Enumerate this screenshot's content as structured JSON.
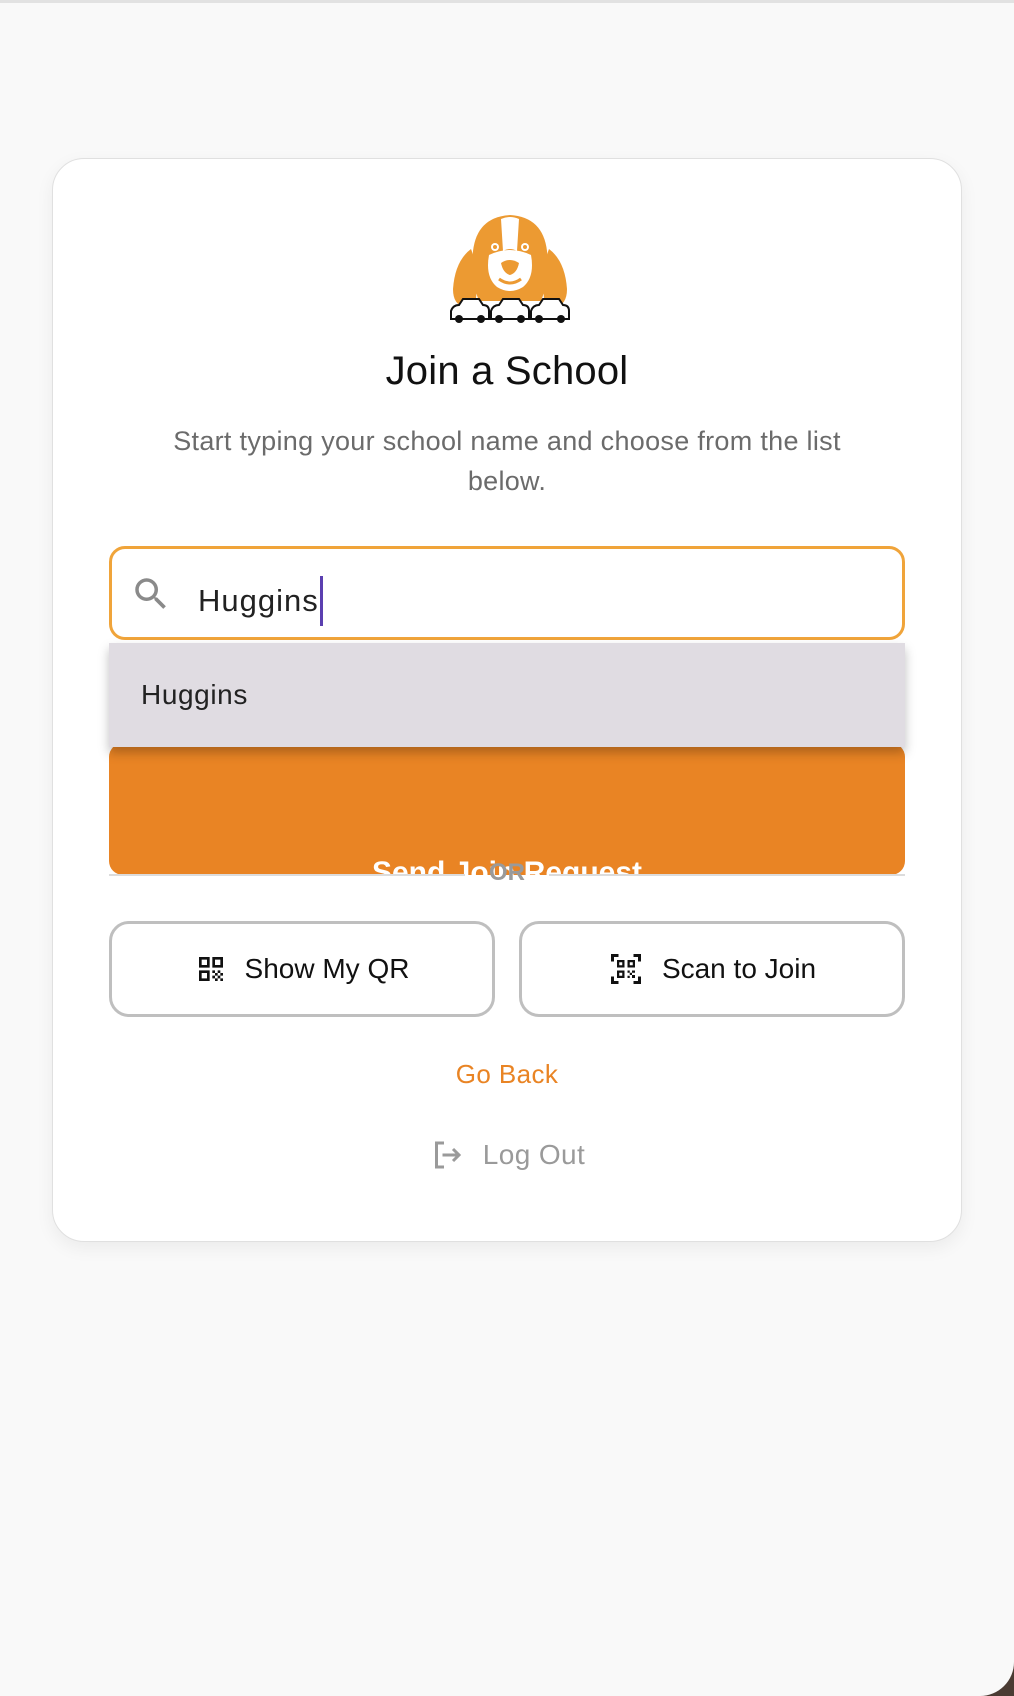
{
  "page": {
    "title": "Join a School",
    "subtitle": "Start typing your school name and choose from the list below."
  },
  "search": {
    "value": "Huggins",
    "icon": "search-icon"
  },
  "dropdown": {
    "options": [
      "Huggins"
    ]
  },
  "actions": {
    "send_label": "Send Join Request",
    "or_label": "OR",
    "show_qr_label": "Show My QR",
    "scan_label": "Scan to Join",
    "go_back_label": "Go Back",
    "logout_label": "Log Out"
  },
  "colors": {
    "accent": "#e98424",
    "focus_border": "#f0a43a",
    "caret": "#5b3fb0",
    "dropdown_bg": "#e0dce2"
  }
}
